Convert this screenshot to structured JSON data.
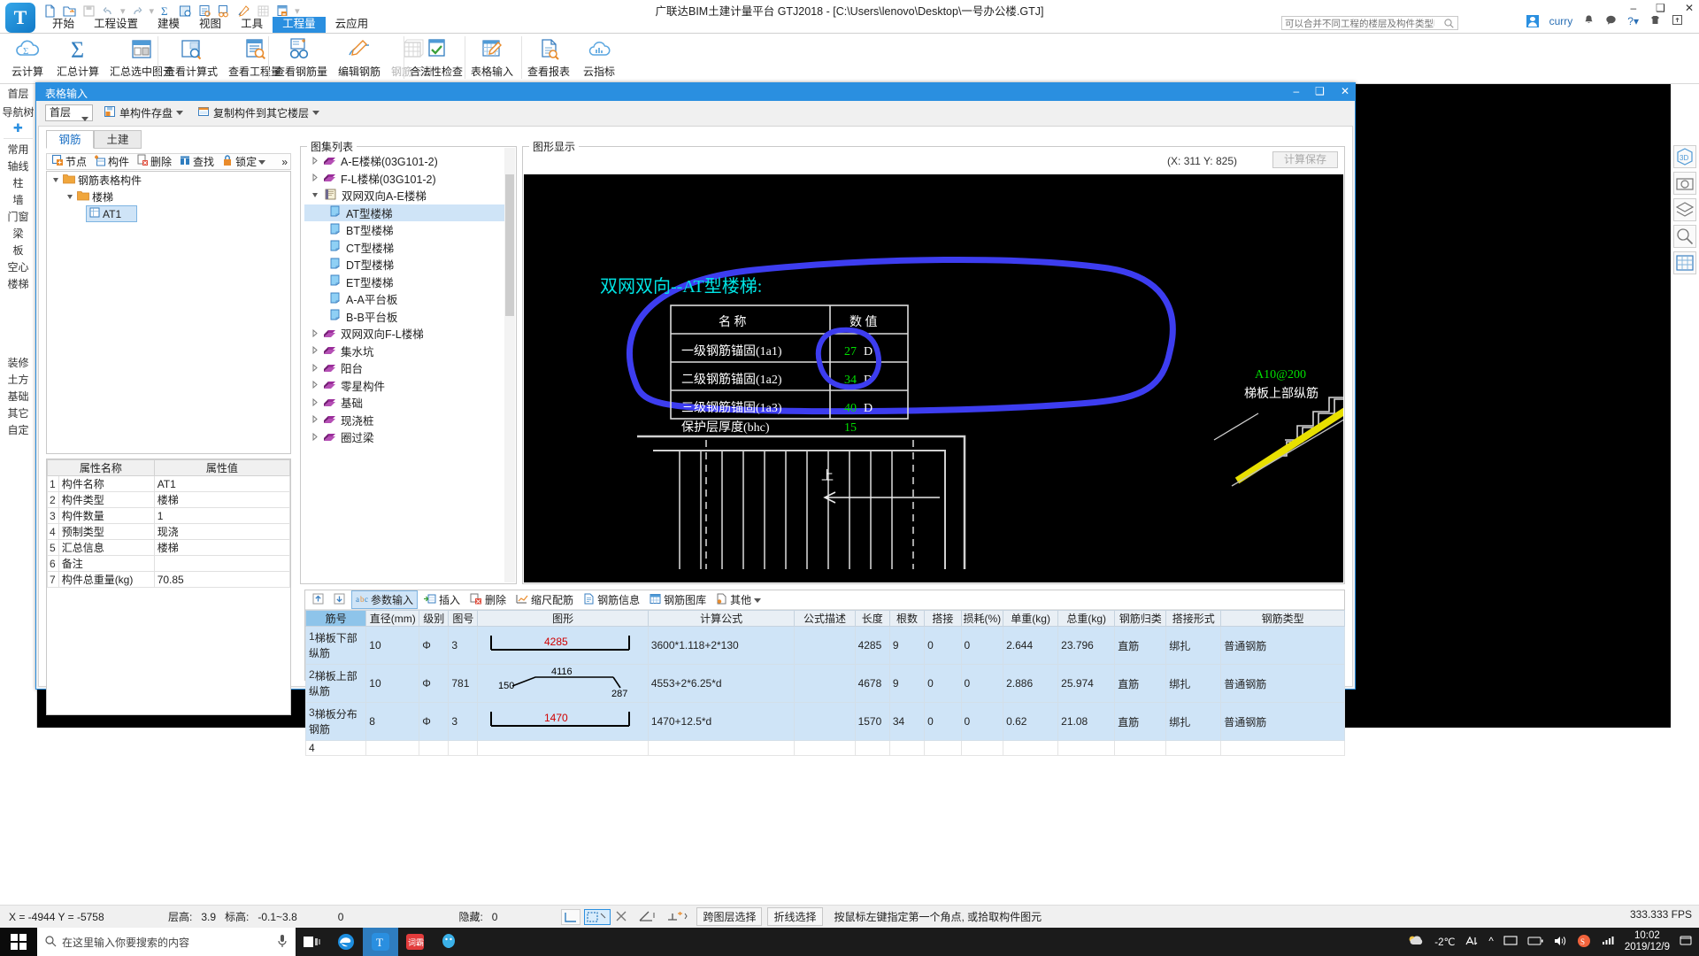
{
  "window": {
    "title": "广联达BIM土建计量平台 GTJ2018 - [C:\\Users\\lenovo\\Desktop\\一号办公楼.GTJ]",
    "minimize": "—",
    "maximize": "❐",
    "close": "✕"
  },
  "search": {
    "placeholder": "可以合并不同工程的楼层及构件类型吗?",
    "value": ""
  },
  "user": {
    "name": "curry"
  },
  "ribbon": {
    "tabs": [
      {
        "label": "开始",
        "active": false
      },
      {
        "label": "工程设置",
        "active": false
      },
      {
        "label": "建模",
        "active": false
      },
      {
        "label": "视图",
        "active": false
      },
      {
        "label": "工具",
        "active": false
      },
      {
        "label": "工程量",
        "active": true
      },
      {
        "label": "云应用",
        "active": false
      }
    ],
    "buttons": [
      {
        "label": "云计算",
        "icon": "cloud-sigma-icon",
        "disabled": false
      },
      {
        "label": "汇总计算",
        "icon": "sigma-icon",
        "disabled": false
      },
      {
        "label": "汇总选中图元",
        "icon": "table-select-icon",
        "disabled": false
      },
      {
        "label": "查看计算式",
        "icon": "formula-search-icon",
        "disabled": false
      },
      {
        "label": "查看工程量",
        "icon": "doc-search-icon",
        "disabled": false
      },
      {
        "label": "查看钢筋量",
        "icon": "glasses-icon",
        "disabled": false
      },
      {
        "label": "编辑钢筋",
        "icon": "pencil-arc-icon",
        "disabled": false
      },
      {
        "label": "钢筋三维",
        "icon": "grid3d-icon",
        "disabled": true
      },
      {
        "label": "合法性检查",
        "icon": "check-icon",
        "disabled": false
      },
      {
        "label": "表格输入",
        "icon": "table-pencil-icon",
        "disabled": false
      },
      {
        "label": "查看报表",
        "icon": "report-icon",
        "disabled": false
      },
      {
        "label": "云指标",
        "icon": "cloud-chart-icon",
        "disabled": false
      }
    ]
  },
  "leftdock": {
    "top": [
      "首层",
      "导航树"
    ],
    "items": [
      "常用",
      "轴线",
      "柱",
      "墙",
      "门窗",
      "梁",
      "板",
      "空心",
      "楼梯"
    ],
    "items2": [
      "装修",
      "土方",
      "基础",
      "其它",
      "自定"
    ]
  },
  "dialog": {
    "title": "表格输入",
    "min": "—",
    "max": "❐",
    "close": "✕",
    "toolbar": {
      "floor": "首层",
      "save_component": "单构件存盘",
      "copy_component": "复制构件到其它楼层"
    },
    "tabs": [
      {
        "label": "钢筋",
        "active": true
      },
      {
        "label": "土建",
        "active": false
      }
    ],
    "tree_toolbar": [
      {
        "label": "节点",
        "icon": "node-add-icon"
      },
      {
        "label": "构件",
        "icon": "component-add-icon"
      },
      {
        "label": "删除",
        "icon": "delete-icon"
      },
      {
        "label": "查找",
        "icon": "find-icon"
      },
      {
        "label": "锁定",
        "icon": "lock-icon"
      },
      {
        "label": "",
        "icon": "more-chevrons-icon"
      }
    ],
    "tree": [
      {
        "label": "钢筋表格构件",
        "level": 0,
        "icon": "folder-icon",
        "expanded": true,
        "selected": false
      },
      {
        "label": "楼梯",
        "level": 1,
        "icon": "folder-icon",
        "expanded": true,
        "selected": false
      },
      {
        "label": "AT1",
        "level": 2,
        "icon": "component-icon",
        "expanded": false,
        "selected": true
      }
    ],
    "properties": {
      "headers": [
        "属性名称",
        "属性值"
      ],
      "rows": [
        {
          "n": "1",
          "k": "构件名称",
          "v": "AT1"
        },
        {
          "n": "2",
          "k": "构件类型",
          "v": "楼梯"
        },
        {
          "n": "3",
          "k": "构件数量",
          "v": "1"
        },
        {
          "n": "4",
          "k": "预制类型",
          "v": "现浇"
        },
        {
          "n": "5",
          "k": "汇总信息",
          "v": "楼梯"
        },
        {
          "n": "6",
          "k": "备注",
          "v": ""
        },
        {
          "n": "7",
          "k": "构件总重量(kg)",
          "v": "70.85"
        }
      ]
    },
    "atlas": {
      "legend": "图集列表",
      "items": [
        {
          "label": "A-E楼梯(03G101-2)",
          "level": 0,
          "icon": "book-icon",
          "expanded": false,
          "selected": false
        },
        {
          "label": "F-L楼梯(03G101-2)",
          "level": 0,
          "icon": "book-icon",
          "expanded": false,
          "selected": false
        },
        {
          "label": "双网双向A-E楼梯",
          "level": 0,
          "icon": "book-open-icon",
          "expanded": true,
          "selected": false
        },
        {
          "label": "AT型楼梯",
          "level": 1,
          "icon": "page-icon",
          "expanded": null,
          "selected": true
        },
        {
          "label": "BT型楼梯",
          "level": 1,
          "icon": "page-icon",
          "expanded": null,
          "selected": false
        },
        {
          "label": "CT型楼梯",
          "level": 1,
          "icon": "page-icon",
          "expanded": null,
          "selected": false
        },
        {
          "label": "DT型楼梯",
          "level": 1,
          "icon": "page-icon",
          "expanded": null,
          "selected": false
        },
        {
          "label": "ET型楼梯",
          "level": 1,
          "icon": "page-icon",
          "expanded": null,
          "selected": false
        },
        {
          "label": "A-A平台板",
          "level": 1,
          "icon": "page-icon",
          "expanded": null,
          "selected": false
        },
        {
          "label": "B-B平台板",
          "level": 1,
          "icon": "page-icon",
          "expanded": null,
          "selected": false
        },
        {
          "label": "双网双向F-L楼梯",
          "level": 0,
          "icon": "book-icon",
          "expanded": false,
          "selected": false
        },
        {
          "label": "集水坑",
          "level": 0,
          "icon": "book-icon",
          "expanded": false,
          "selected": false
        },
        {
          "label": "阳台",
          "level": 0,
          "icon": "book-icon",
          "expanded": false,
          "selected": false
        },
        {
          "label": "零星构件",
          "level": 0,
          "icon": "book-icon",
          "expanded": false,
          "selected": false
        },
        {
          "label": "基础",
          "level": 0,
          "icon": "book-icon",
          "expanded": false,
          "selected": false
        },
        {
          "label": "现浇桩",
          "level": 0,
          "icon": "book-icon",
          "expanded": false,
          "selected": false
        },
        {
          "label": "圈过梁",
          "level": 0,
          "icon": "book-icon",
          "expanded": false,
          "selected": false
        }
      ]
    },
    "graphics": {
      "legend": "图形显示",
      "coord": "(X: 311 Y: 825)",
      "calc_save": "计算保存",
      "drawing": {
        "title": "双网双向--AT型楼梯:",
        "table_headers": [
          "名  称",
          "数  值"
        ],
        "table_rows": [
          {
            "name": "一级钢筋锚固(1a1)",
            "value": "27",
            "unit": "D"
          },
          {
            "name": "二级钢筋锚固(1a2)",
            "value": "34",
            "unit": "D"
          },
          {
            "name": "三级钢筋锚固(1a3)",
            "value": "40",
            "unit": "D"
          },
          {
            "name": "保护层厚度(bhc)",
            "value": "15",
            "unit": ""
          }
        ],
        "annotation_right": "A10@200",
        "annotation_right2": "梯板上部纵筋",
        "arrow_label": "上"
      }
    },
    "grid": {
      "toolbar": [
        {
          "label": "",
          "icon": "move-up-icon",
          "active": false
        },
        {
          "label": "",
          "icon": "move-down-icon",
          "active": false
        },
        {
          "label": "参数输入",
          "icon": "param-input-icon",
          "active": true
        },
        {
          "label": "插入",
          "icon": "insert-icon",
          "active": false
        },
        {
          "label": "删除",
          "icon": "delete-icon",
          "active": false
        },
        {
          "label": "缩尺配筋",
          "icon": "scale-rebar-icon",
          "active": false
        },
        {
          "label": "钢筋信息",
          "icon": "rebar-info-icon",
          "active": false
        },
        {
          "label": "钢筋图库",
          "icon": "rebar-library-icon",
          "active": false
        },
        {
          "label": "其他",
          "icon": "other-icon",
          "active": false
        }
      ],
      "headers": [
        "筋号",
        "直径(mm)",
        "级别",
        "图号",
        "图形",
        "计算公式",
        "公式描述",
        "长度",
        "根数",
        "搭接",
        "损耗(%)",
        "单重(kg)",
        "总重(kg)",
        "钢筋归类",
        "搭接形式",
        "钢筋类型"
      ],
      "rows": [
        {
          "index": "1",
          "name": "梯板下部纵筋",
          "diameter": "10",
          "grade": "Φ",
          "tuhao": "3",
          "shape_label": "4285",
          "shape_type": "u-bar",
          "formula": "3600*1.118+2*130",
          "formula_desc": "",
          "length": "4285",
          "count": "9",
          "lap": "0",
          "loss": "0",
          "unit_weight": "2.644",
          "total_weight": "23.796",
          "classify": "直筋",
          "lap_form": "绑扎",
          "rebar_type": "普通钢筋"
        },
        {
          "index": "2",
          "name": "梯板上部纵筋",
          "diameter": "10",
          "grade": "Φ",
          "tuhao": "781",
          "shape_label": "4116",
          "shape_left": "150",
          "shape_right": "287",
          "shape_type": "z-bar",
          "formula": "4553+2*6.25*d",
          "formula_desc": "",
          "length": "4678",
          "count": "9",
          "lap": "0",
          "loss": "0",
          "unit_weight": "2.886",
          "total_weight": "25.974",
          "classify": "直筋",
          "lap_form": "绑扎",
          "rebar_type": "普通钢筋"
        },
        {
          "index": "3",
          "name": "梯板分布钢筋",
          "diameter": "8",
          "grade": "Φ",
          "tuhao": "3",
          "shape_label": "1470",
          "shape_type": "u-bar",
          "formula": "1470+12.5*d",
          "formula_desc": "",
          "length": "1570",
          "count": "34",
          "lap": "0",
          "loss": "0",
          "unit_weight": "0.62",
          "total_weight": "21.08",
          "classify": "直筋",
          "lap_form": "绑扎",
          "rebar_type": "普通钢筋"
        }
      ],
      "empty_row_index": "4"
    }
  },
  "statusbar": {
    "coords": "X = -4944 Y = -5758",
    "floor_height_label": "层高:",
    "floor_height": "3.9",
    "elev_label": "标高:",
    "elev": "-0.1~3.8",
    "zero": "0",
    "hidden_label": "隐藏:",
    "hidden": "0",
    "btn1": "跨图层选择",
    "btn2": "折线选择",
    "hint": "按鼠标左键指定第一个角点, 或拾取构件图元",
    "fps": "333.333 FPS"
  },
  "taskbar": {
    "search_placeholder": "在这里输入你要搜索的内容",
    "temp": "-2℃",
    "time": "10:02",
    "date": "2019/12/9"
  }
}
